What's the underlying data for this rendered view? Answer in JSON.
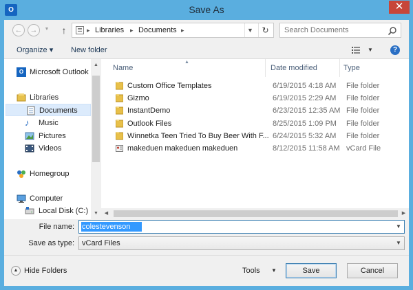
{
  "window": {
    "title": "Save As",
    "app_icon_text": "O",
    "close_glyph": "✕",
    "accent": "#5aaedf"
  },
  "address": {
    "breadcrumb": [
      "Libraries",
      "Documents"
    ],
    "search_placeholder": "Search Documents"
  },
  "toolbar": {
    "organize_label": "Organize ▾",
    "new_folder_label": "New folder",
    "help_glyph": "?"
  },
  "nav": {
    "items": [
      {
        "label": "Microsoft Outlook",
        "icon": "outlook-icon"
      },
      {
        "label": "Libraries",
        "icon": "libraries-icon"
      },
      {
        "label": "Documents",
        "icon": "documents-icon",
        "selected": true
      },
      {
        "label": "Music",
        "icon": "music-icon"
      },
      {
        "label": "Pictures",
        "icon": "pictures-icon"
      },
      {
        "label": "Videos",
        "icon": "videos-icon"
      },
      {
        "label": "Homegroup",
        "icon": "homegroup-icon"
      },
      {
        "label": "Computer",
        "icon": "computer-icon"
      },
      {
        "label": "Local Disk (C:)",
        "icon": "disk-icon"
      }
    ]
  },
  "files": {
    "columns": {
      "name": "Name",
      "date": "Date modified",
      "type": "Type"
    },
    "rows": [
      {
        "name": "Custom Office Templates",
        "date": "6/19/2015 4:18 AM",
        "type": "File folder",
        "icon": "folder-icon"
      },
      {
        "name": "Gizmo",
        "date": "6/19/2015 2:29 AM",
        "type": "File folder",
        "icon": "folder-icon"
      },
      {
        "name": "InstantDemo",
        "date": "6/23/2015 12:35 AM",
        "type": "File folder",
        "icon": "folder-icon"
      },
      {
        "name": "Outlook Files",
        "date": "8/25/2015 1:09 PM",
        "type": "File folder",
        "icon": "folder-icon"
      },
      {
        "name": "Winnetka Teen Tried To Buy Beer With F...",
        "date": "6/24/2015 5:32 AM",
        "type": "File folder",
        "icon": "folder-icon"
      },
      {
        "name": "makeduen makeduen makeduen",
        "date": "8/12/2015 11:58 AM",
        "type": "vCard File",
        "icon": "vcard-icon"
      }
    ]
  },
  "form": {
    "filename_label": "File name:",
    "filename_value": "colestevenson",
    "savetype_label": "Save as type:",
    "savetype_value": "vCard Files"
  },
  "footer": {
    "hide_folders_label": "Hide Folders",
    "tools_label": "Tools",
    "save_label": "Save",
    "cancel_label": "Cancel"
  }
}
